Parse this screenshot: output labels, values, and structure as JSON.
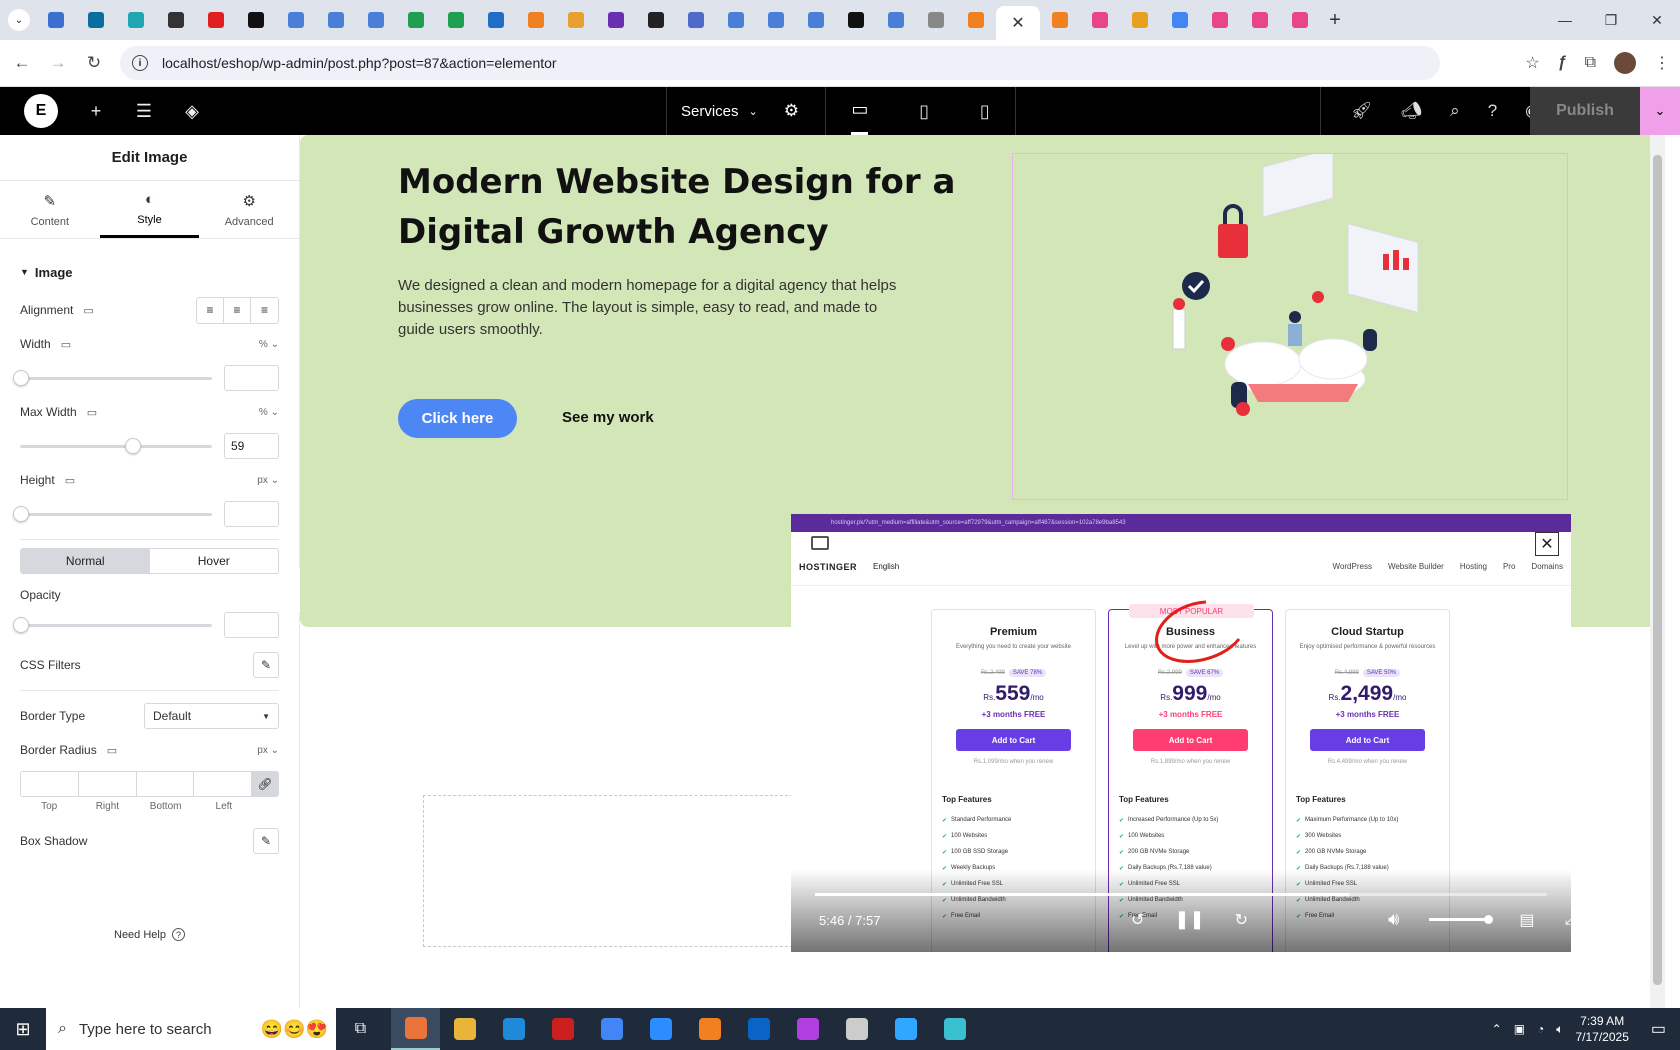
{
  "browser": {
    "url": "localhost/eshop/wp-admin/post.php?post=87&action=elementor",
    "tab_favicons": [
      "#3b6fd0",
      "#0a6e9e",
      "#22a6b3",
      "#333333",
      "#e02020",
      "#111111",
      "#4a7fd8",
      "#4a7fd8",
      "#4a7fd8",
      "#1e9e50",
      "#1e9e50",
      "#1f6ec8",
      "#f08020",
      "#e8a030",
      "#6a2fb0",
      "#222222",
      "#4f6ac8",
      "#4a7fd8",
      "#4a7fd8",
      "#4a7fd8",
      "#111111",
      "#4a7fd8",
      "#888888",
      "#f08020"
    ],
    "tab_favicons_right": [
      "#f08020",
      "#e8458a",
      "#e8a020",
      "#4285f4",
      "#e8458a",
      "#e8458a",
      "#e8458a"
    ]
  },
  "elementor": {
    "document_name": "Services",
    "publish_label": "Publish"
  },
  "panel": {
    "title": "Edit Image",
    "tabs": [
      {
        "label": "Content",
        "icon": "pencil-icon"
      },
      {
        "label": "Style",
        "icon": "contrast-icon"
      },
      {
        "label": "Advanced",
        "icon": "gear-icon"
      }
    ],
    "section_title": "Image",
    "alignment_label": "Alignment",
    "width_label": "Width",
    "width_unit": "%",
    "width_value": "",
    "max_width_label": "Max Width",
    "max_width_unit": "%",
    "max_width_value": "59",
    "height_label": "Height",
    "height_unit": "px",
    "height_value": "",
    "state_normal": "Normal",
    "state_hover": "Hover",
    "opacity_label": "Opacity",
    "css_filters_label": "CSS Filters",
    "border_type_label": "Border Type",
    "border_type_value": "Default",
    "border_radius_label": "Border Radius",
    "border_radius_unit": "px",
    "dim_labels": [
      "Top",
      "Right",
      "Bottom",
      "Left"
    ],
    "box_shadow_label": "Box Shadow",
    "need_help": "Need Help"
  },
  "hero": {
    "title": "Modern Website Design for a Digital Growth Agency",
    "description": "We designed a clean and modern homepage for a digital agency that helps businesses grow online. The layout is simple, easy to read, and made to guide users smoothly.",
    "cta_label": "Click here",
    "secondary_label": "See my work"
  },
  "video": {
    "url_text": "hostinger.pk/?utm_medium=affiliate&utm_source=aff72979&utm_campaign=aff487&session=102a78e9ba8543",
    "brand": "HOSTINGER",
    "lang": "English",
    "nav_links": [
      "WordPress",
      "Website Builder",
      "Hosting",
      "Pro",
      "Domains"
    ],
    "plans": [
      {
        "name": "Premium",
        "desc": "Everything you need to create your website",
        "old": "Rs.2,499",
        "save": "SAVE 78%",
        "currency": "Rs.",
        "price": "559",
        "per": "/mo",
        "free": "+3 months FREE",
        "cart": "Add to Cart",
        "renew": "Rs.1,099/mo when you renew",
        "features": [
          "Standard Performance",
          "100 Websites",
          "100 GB SSD Storage",
          "Weekly Backups",
          "Unlimited Free SSL",
          "Unlimited Bandwidth",
          "Free Email"
        ]
      },
      {
        "name": "Business",
        "tag": "MOST POPULAR",
        "desc": "Level up with more power and enhanced features",
        "old": "Rs.2,999",
        "save": "SAVE 67%",
        "currency": "Rs.",
        "price": "999",
        "per": "/mo",
        "free": "+3 months FREE",
        "cart": "Add to Cart",
        "renew": "Rs.1,899/mo when you renew",
        "features": [
          "Increased Performance (Up to 5x)",
          "100 Websites",
          "200 GB NVMe Storage",
          "Daily Backups (Rs.7,188 value)",
          "Unlimited Free SSL",
          "Unlimited Bandwidth",
          "Free Email"
        ]
      },
      {
        "name": "Cloud Startup",
        "desc": "Enjoy optimised performance & powerful resources",
        "old": "Rs.4,999",
        "save": "SAVE 50%",
        "currency": "Rs.",
        "price": "2,499",
        "per": "/mo",
        "free": "+3 months FREE",
        "cart": "Add to Cart",
        "renew": "Rs.4,499/mo when you renew",
        "features": [
          "Maximum Performance (Up to 10x)",
          "300 Websites",
          "200 GB NVMe Storage",
          "Daily Backups (Rs.7,188 value)",
          "Unlimited Free SSL",
          "Unlimited Bandwidth",
          "Free Email"
        ]
      }
    ],
    "features_title": "Top Features",
    "time": "5:46 / 7:57",
    "progress": 0.729
  },
  "taskbar": {
    "search_placeholder": "Type here to search",
    "apps": [
      "#e8743a",
      "#e8b53a",
      "#1f8ad8",
      "#cc2020",
      "#4285f4",
      "#2d8cff",
      "#f08020",
      "#0a64c8",
      "#b040e0",
      "#cccccc",
      "#31a8ff",
      "#3ac0d0"
    ],
    "time": "7:39 AM",
    "date": "7/17/2025"
  }
}
